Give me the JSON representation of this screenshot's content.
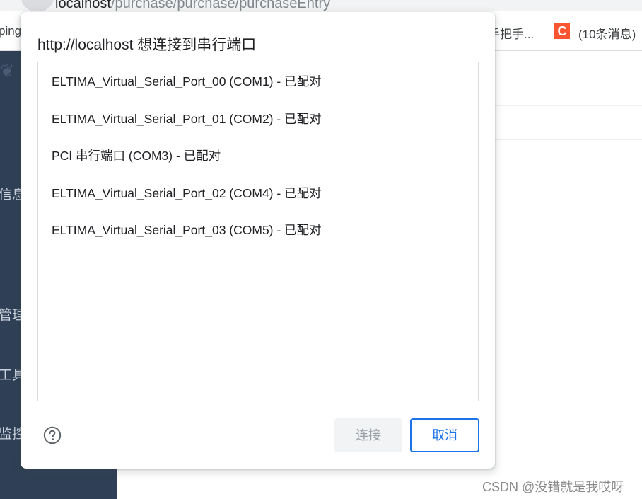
{
  "browser": {
    "url_host": "localhost",
    "url_path": "/purchase/purchase/purchaseEntry",
    "bookmarks": {
      "left_partial": "ping",
      "mid_partial": "手把手...",
      "csdn_icon_letter": "C",
      "right_label": "(10条消息)"
    }
  },
  "app": {
    "sidebar_items": [
      "信息",
      "管理",
      "工具",
      "监控"
    ]
  },
  "dialog": {
    "title": "http://localhost 想连接到串行端口",
    "ports": [
      "ELTIMA_Virtual_Serial_Port_00 (COM1) - 已配对",
      "ELTIMA_Virtual_Serial_Port_01 (COM2) - 已配对",
      "PCI 串行端口 (COM3) - 已配对",
      "ELTIMA_Virtual_Serial_Port_02 (COM4) - 已配对",
      "ELTIMA_Virtual_Serial_Port_03 (COM5) - 已配对"
    ],
    "connect_label": "连接",
    "cancel_label": "取消",
    "help_icon": "help-circle-icon"
  },
  "watermark": "CSDN @没错就是我哎呀",
  "colors": {
    "sidebar": "#2f4056",
    "accent": "#1a73e8",
    "csdn": "#fc5531"
  }
}
